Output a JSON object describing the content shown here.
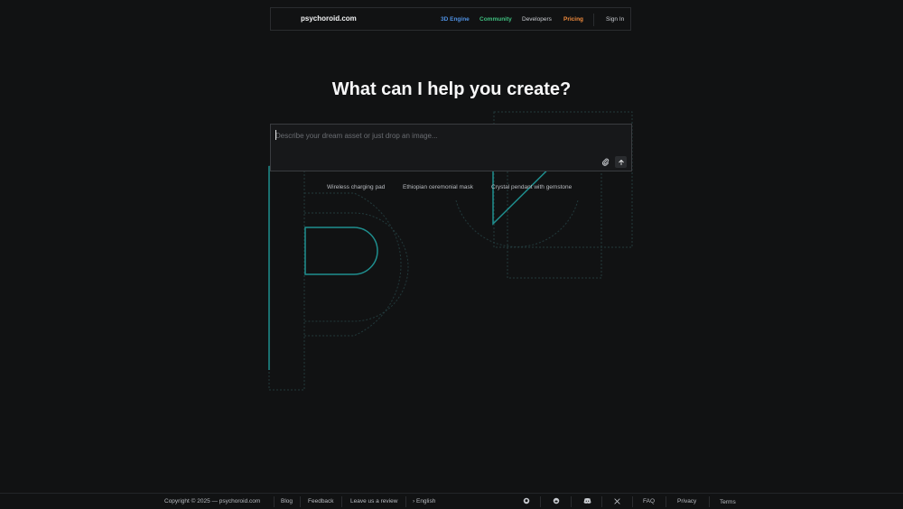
{
  "header": {
    "brand": "psychoroid.com",
    "nav": {
      "engine": "3D Engine",
      "community": "Community",
      "developers": "Developers",
      "pricing": "Pricing",
      "signin": "Sign In"
    }
  },
  "hero": {
    "title": "What can I help you create?"
  },
  "prompt": {
    "placeholder": "Describe your dream asset or just drop an image...",
    "value": ""
  },
  "suggestions": [
    "Wireless charging pad",
    "Ethiopian ceremonial mask",
    "Crystal pendant with gemstone"
  ],
  "footer": {
    "copyright": "Copyright © 2025 — psychoroid.com",
    "blog": "Blog",
    "feedback": "Feedback",
    "review": "Leave us a review",
    "language": "English",
    "faq": "FAQ",
    "privacy": "Privacy",
    "terms": "Terms"
  },
  "colors": {
    "background": "#111213",
    "engine": "#4e8fe0",
    "community": "#3fbf7f",
    "pricing": "#f08a3c",
    "accent_teal": "#1fa3a3"
  },
  "icons": [
    "paperclip-icon",
    "arrow-up-icon",
    "github-icon",
    "reddit-icon",
    "discord-icon",
    "x-icon",
    "chevron-right-icon"
  ]
}
